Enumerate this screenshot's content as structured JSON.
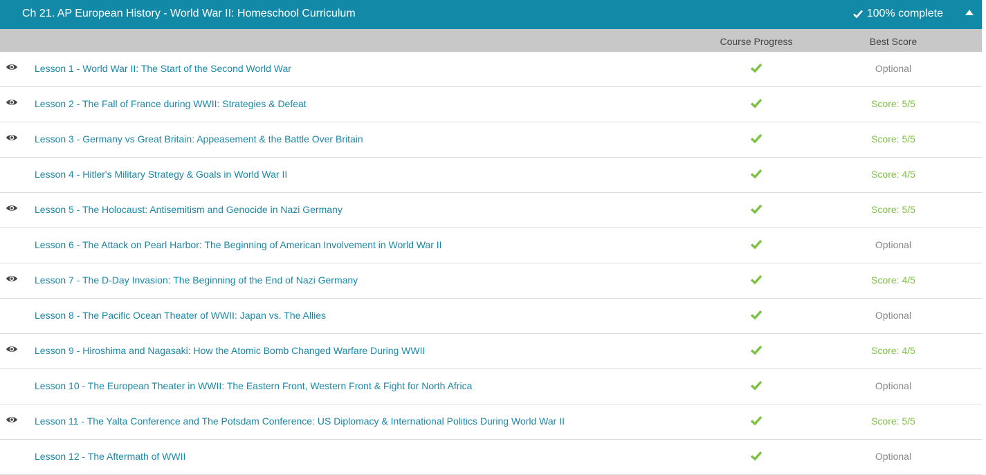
{
  "header": {
    "title": "Ch 21. AP European History - World War II: Homeschool Curriculum",
    "complete_label": "100% complete"
  },
  "columns": {
    "progress": "Course Progress",
    "score": "Best Score"
  },
  "lessons": [
    {
      "title": "Lesson 1 - World War II: The Start of the Second World War",
      "has_eye": true,
      "score": "Optional",
      "optional": true
    },
    {
      "title": "Lesson 2 - The Fall of France during WWII: Strategies & Defeat",
      "has_eye": true,
      "score": "Score: 5/5",
      "optional": false
    },
    {
      "title": "Lesson 3 - Germany vs Great Britain: Appeasement & the Battle Over Britain",
      "has_eye": true,
      "score": "Score: 5/5",
      "optional": false
    },
    {
      "title": "Lesson 4 - Hitler's Military Strategy & Goals in World War II",
      "has_eye": false,
      "score": "Score: 4/5",
      "optional": false
    },
    {
      "title": "Lesson 5 - The Holocaust: Antisemitism and Genocide in Nazi Germany",
      "has_eye": true,
      "score": "Score: 5/5",
      "optional": false
    },
    {
      "title": "Lesson 6 - The Attack on Pearl Harbor: The Beginning of American Involvement in World War II",
      "has_eye": false,
      "score": "Optional",
      "optional": true
    },
    {
      "title": "Lesson 7 - The D-Day Invasion: The Beginning of the End of Nazi Germany",
      "has_eye": true,
      "score": "Score: 4/5",
      "optional": false
    },
    {
      "title": "Lesson 8 - The Pacific Ocean Theater of WWII: Japan vs. The Allies",
      "has_eye": false,
      "score": "Optional",
      "optional": true
    },
    {
      "title": "Lesson 9 - Hiroshima and Nagasaki: How the Atomic Bomb Changed Warfare During WWII",
      "has_eye": true,
      "score": "Score: 4/5",
      "optional": false
    },
    {
      "title": "Lesson 10 - The European Theater in WWII: The Eastern Front, Western Front & Fight for North Africa",
      "has_eye": false,
      "score": "Optional",
      "optional": true
    },
    {
      "title": "Lesson 11 - The Yalta Conference and The Potsdam Conference: US Diplomacy & International Politics During World War II",
      "has_eye": true,
      "score": "Score: 5/5",
      "optional": false
    },
    {
      "title": "Lesson 12 - The Aftermath of WWII",
      "has_eye": false,
      "score": "Optional",
      "optional": true
    }
  ],
  "colors": {
    "header_bg": "#1289a7",
    "link": "#1a87a6",
    "check": "#7cc242",
    "optional": "#888888"
  },
  "icons": {
    "viewed": "eye-icon",
    "completed": "checkmark-icon",
    "collapse": "caret-up-icon"
  }
}
